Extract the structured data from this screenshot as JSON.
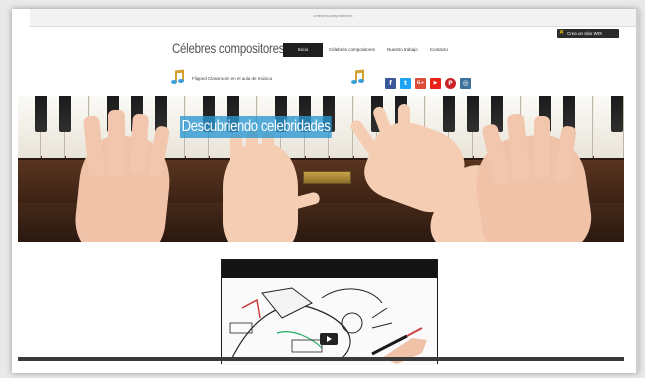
{
  "browser": {
    "url": "celebrescompositores"
  },
  "wix_badge": {
    "label": "Crea un sitio WIX",
    "icon": "wix-x-icon",
    "accent": "#f5c400"
  },
  "header": {
    "site_title": "Célebres compositores"
  },
  "nav": {
    "items": [
      {
        "label": "Inicio",
        "active": true
      },
      {
        "label": "Célebres compositores",
        "active": false
      },
      {
        "label": "Nuestro trabajo",
        "active": false
      },
      {
        "label": "Contacto",
        "active": false
      }
    ]
  },
  "subline": {
    "text": "Flipped Classroom en  el aula de música",
    "icon": "music-note-icon"
  },
  "social": {
    "items": [
      {
        "label": "f",
        "icon": "facebook-icon",
        "color": "#3b5998"
      },
      {
        "label": "t",
        "icon": "twitter-icon",
        "color": "#1da1f2"
      },
      {
        "label": "G+",
        "icon": "google-plus-icon",
        "color": "#dd4b39"
      },
      {
        "label": "▶",
        "icon": "youtube-icon",
        "color": "#e62117"
      },
      {
        "label": "P",
        "icon": "pinterest-icon",
        "color": "#cb2027"
      },
      {
        "label": "◎",
        "icon": "instagram-icon",
        "color": "#3f729b"
      }
    ]
  },
  "hero": {
    "caption": "Descubriendo celebridades",
    "caption_bg": "#2896d2"
  },
  "video": {
    "play_icon": "play-icon"
  }
}
